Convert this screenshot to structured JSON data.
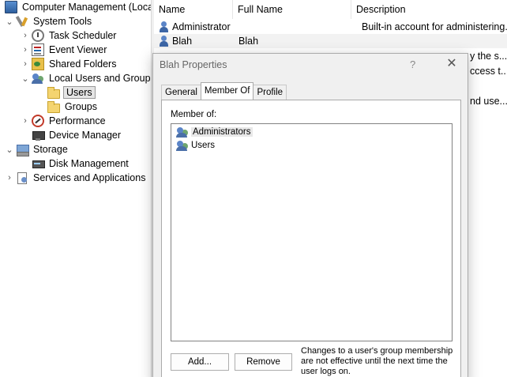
{
  "tree": {
    "items": [
      {
        "label": "Computer Management (Local",
        "expander": "",
        "icon": "computer-icon"
      },
      {
        "label": "System Tools",
        "expander": "⌄",
        "icon": "tools-icon"
      },
      {
        "label": "Task Scheduler",
        "expander": "›",
        "icon": "clock-icon"
      },
      {
        "label": "Event Viewer",
        "expander": "›",
        "icon": "event-viewer-icon"
      },
      {
        "label": "Shared Folders",
        "expander": "›",
        "icon": "shared-folder-icon"
      },
      {
        "label": "Local Users and Groups",
        "expander": "⌄",
        "icon": "users-groups-icon"
      },
      {
        "label": "Users",
        "expander": "",
        "icon": "folder-icon"
      },
      {
        "label": "Groups",
        "expander": "",
        "icon": "folder-icon"
      },
      {
        "label": "Performance",
        "expander": "›",
        "icon": "performance-icon"
      },
      {
        "label": "Device Manager",
        "expander": "",
        "icon": "device-manager-icon"
      },
      {
        "label": "Storage",
        "expander": "⌄",
        "icon": "storage-icon"
      },
      {
        "label": "Disk Management",
        "expander": "",
        "icon": "disk-icon"
      },
      {
        "label": "Services and Applications",
        "expander": "›",
        "icon": "services-icon"
      }
    ]
  },
  "list": {
    "columns": [
      "Name",
      "Full Name",
      "Description"
    ],
    "rows": [
      {
        "name": "Administrator",
        "full_name": "",
        "description": "Built-in account for administering..."
      },
      {
        "name": "Blah",
        "full_name": "Blah",
        "description": ""
      }
    ],
    "partial_descriptions": [
      "y the s...",
      "ccess t...",
      "nd use..."
    ]
  },
  "dialog": {
    "title": "Blah Properties",
    "help": "?",
    "close": "✕",
    "tabs": [
      "General",
      "Member Of",
      "Profile"
    ],
    "member_of_label": "Member of:",
    "groups": [
      "Administrators",
      "Users"
    ],
    "add_button": "Add...",
    "remove_button": "Remove",
    "note": "Changes to a user's group membership are not effective until the next time the user logs on."
  }
}
